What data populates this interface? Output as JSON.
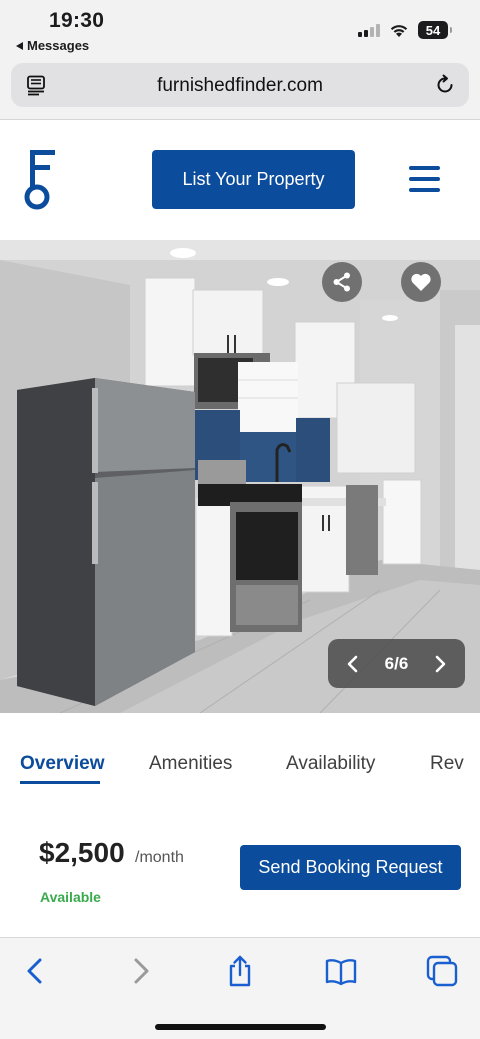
{
  "status_bar": {
    "time": "19:30",
    "back_app": "Messages",
    "battery": "54"
  },
  "browser": {
    "url": "furnishedfinder.com"
  },
  "header": {
    "list_property_label": "List Your Property",
    "menu_icon": "hamburger-menu-icon",
    "logo_icon": "furnished-finder-key-logo"
  },
  "gallery": {
    "counter": "6/6",
    "current": 6,
    "total": 6,
    "share_icon": "share-icon",
    "favorite_icon": "heart-icon"
  },
  "tabs": [
    {
      "label": "Overview",
      "active": true
    },
    {
      "label": "Amenities",
      "active": false
    },
    {
      "label": "Availability",
      "active": false
    },
    {
      "label": "Rev",
      "active": false
    }
  ],
  "listing": {
    "price": "$2,500",
    "period": "/month",
    "status": "Available",
    "booking_label": "Send Booking Request"
  },
  "colors": {
    "brand": "#0b4c9c",
    "available": "#3aaa4e"
  }
}
